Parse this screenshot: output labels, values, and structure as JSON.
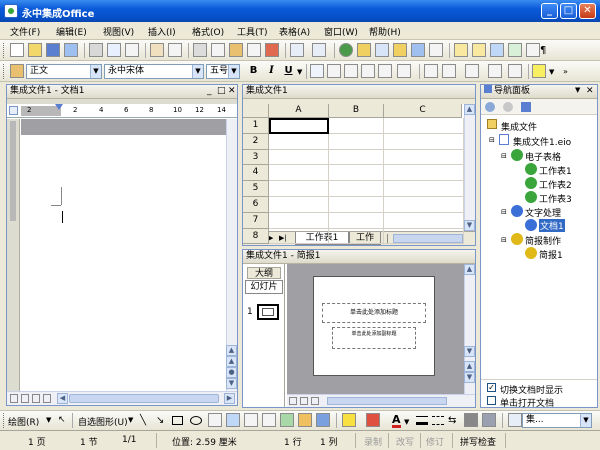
{
  "window": {
    "title": "永中集成Office"
  },
  "menu": [
    "文件(F)",
    "编辑(E)",
    "视图(V)",
    "插入(I)",
    "格式(O)",
    "工具(T)",
    "表格(A)",
    "窗口(W)",
    "帮助(H)"
  ],
  "format_toolbar": {
    "style": "正文",
    "font": "永中宋体",
    "size": "五号",
    "bold": "B",
    "italic": "I",
    "underline": "U"
  },
  "doc_panel": {
    "title": "集成文件1 - 文档1",
    "ruler_ticks": [
      "2",
      "2",
      "4",
      "6",
      "8",
      "10",
      "12",
      "14"
    ]
  },
  "sheet_panel": {
    "title": "集成文件1",
    "columns": [
      "A",
      "B",
      "C"
    ],
    "rows": [
      "1",
      "2",
      "3",
      "4",
      "5",
      "6",
      "7",
      "8"
    ],
    "tabs": [
      "工作表1",
      "工作"
    ]
  },
  "slide_panel": {
    "title": "集成文件1 - 简报1",
    "tab_outline": "大纲",
    "tab_slides": "幻灯片",
    "slide_number": "1",
    "title_placeholder": "单击此处添加标题",
    "subtitle_placeholder": "单击此处添加副标题"
  },
  "task_pane": {
    "title": "导航面板",
    "tree": {
      "root": "集成文件",
      "file": "集成文件1.eio",
      "spreadsheet_group": "电子表格",
      "sheets": [
        "工作表1",
        "工作表2",
        "工作表3"
      ],
      "text_group": "文字处理",
      "doc": "文档1",
      "slides_group": "简报制作",
      "slide_doc": "简报1"
    },
    "options": [
      {
        "label": "切换文档时显示",
        "checked": true
      },
      {
        "label": "单击打开文档",
        "checked": false
      }
    ]
  },
  "draw_toolbar": {
    "draw": "绘图(R)",
    "autoshape": "自选图形(U)",
    "combo": "集..."
  },
  "status": {
    "page": "1 页",
    "section": "1 节",
    "pages": "1/1",
    "position": "位置: 2.59 厘米",
    "line": "1 行",
    "column": "1 列",
    "rec": "录制",
    "ovr": "改写",
    "trk": "修订",
    "spell": "拼写检查"
  },
  "colors": {
    "title_bar": "#0a5ad9",
    "accent": "#316ac5",
    "node_green": "#39a53a",
    "node_blue": "#3a6fd8",
    "node_yellow": "#e0b818"
  }
}
